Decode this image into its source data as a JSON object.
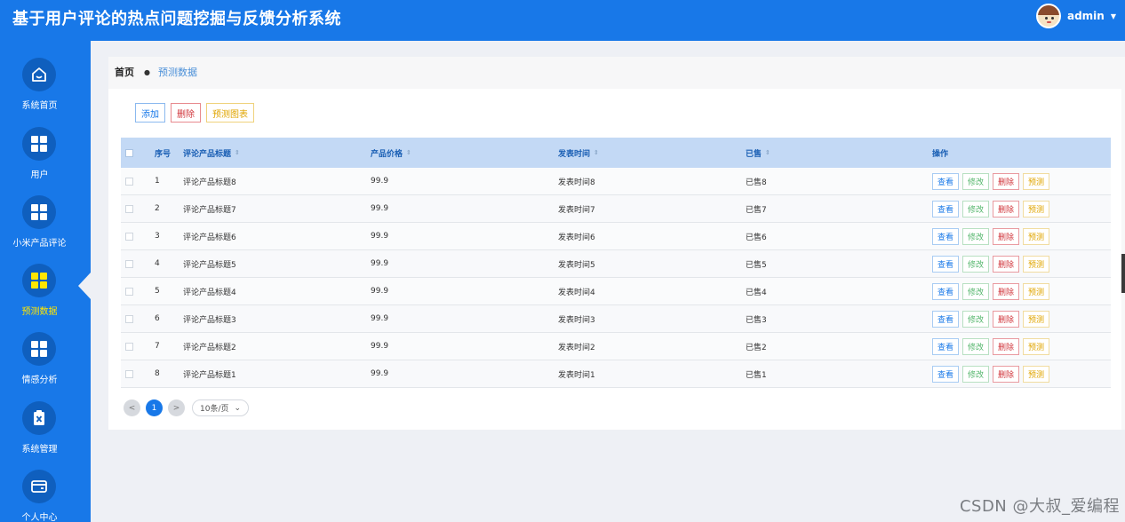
{
  "app": {
    "title": "基于用户评论的热点问题挖掘与反馈分析系统",
    "user": "admin",
    "user_caret": "▼"
  },
  "sidebar": {
    "items": [
      {
        "label": "系统首页",
        "icon": "home-icon"
      },
      {
        "label": "用户",
        "icon": "grid-icon"
      },
      {
        "label": "小米产品评论",
        "icon": "grid-icon"
      },
      {
        "label": "预测数据",
        "icon": "grid-icon",
        "active": true
      },
      {
        "label": "情感分析",
        "icon": "grid-icon"
      },
      {
        "label": "系统管理",
        "icon": "document-x-icon"
      },
      {
        "label": "个人中心",
        "icon": "wallet-icon"
      }
    ]
  },
  "breadcrumb": {
    "home": "首页",
    "separator": "●",
    "current": "预测数据"
  },
  "toolbar": {
    "add_label": "添加",
    "delete_label": "删除",
    "chart_label": "预测图表"
  },
  "table": {
    "headers": {
      "index": "序号",
      "title": "评论产品标题",
      "price": "产品价格",
      "time": "发表时间",
      "sold": "已售",
      "ops": "操作"
    },
    "sort_glyph": "⇕",
    "op_labels": {
      "view": "查看",
      "edit": "修改",
      "delete": "删除",
      "predict": "预测"
    },
    "rows": [
      {
        "index": "1",
        "title": "评论产品标题8",
        "price": "99.9",
        "time": "发表时间8",
        "sold": "已售8"
      },
      {
        "index": "2",
        "title": "评论产品标题7",
        "price": "99.9",
        "time": "发表时间7",
        "sold": "已售7"
      },
      {
        "index": "3",
        "title": "评论产品标题6",
        "price": "99.9",
        "time": "发表时间6",
        "sold": "已售6"
      },
      {
        "index": "4",
        "title": "评论产品标题5",
        "price": "99.9",
        "time": "发表时间5",
        "sold": "已售5"
      },
      {
        "index": "5",
        "title": "评论产品标题4",
        "price": "99.9",
        "time": "发表时间4",
        "sold": "已售4"
      },
      {
        "index": "6",
        "title": "评论产品标题3",
        "price": "99.9",
        "time": "发表时间3",
        "sold": "已售3"
      },
      {
        "index": "7",
        "title": "评论产品标题2",
        "price": "99.9",
        "time": "发表时间2",
        "sold": "已售2"
      },
      {
        "index": "8",
        "title": "评论产品标题1",
        "price": "99.9",
        "time": "发表时间1",
        "sold": "已售1"
      }
    ]
  },
  "pagination": {
    "prev": "<",
    "current_page": "1",
    "next": ">",
    "page_size": "10条/页",
    "caret": "⌄"
  },
  "watermark": "CSDN @大叔_爱编程",
  "colors": {
    "primary": "#1878e8",
    "active_nav": "#ffe600",
    "danger": "#d0343a",
    "warning": "#e0a500",
    "success": "#52b56a"
  }
}
